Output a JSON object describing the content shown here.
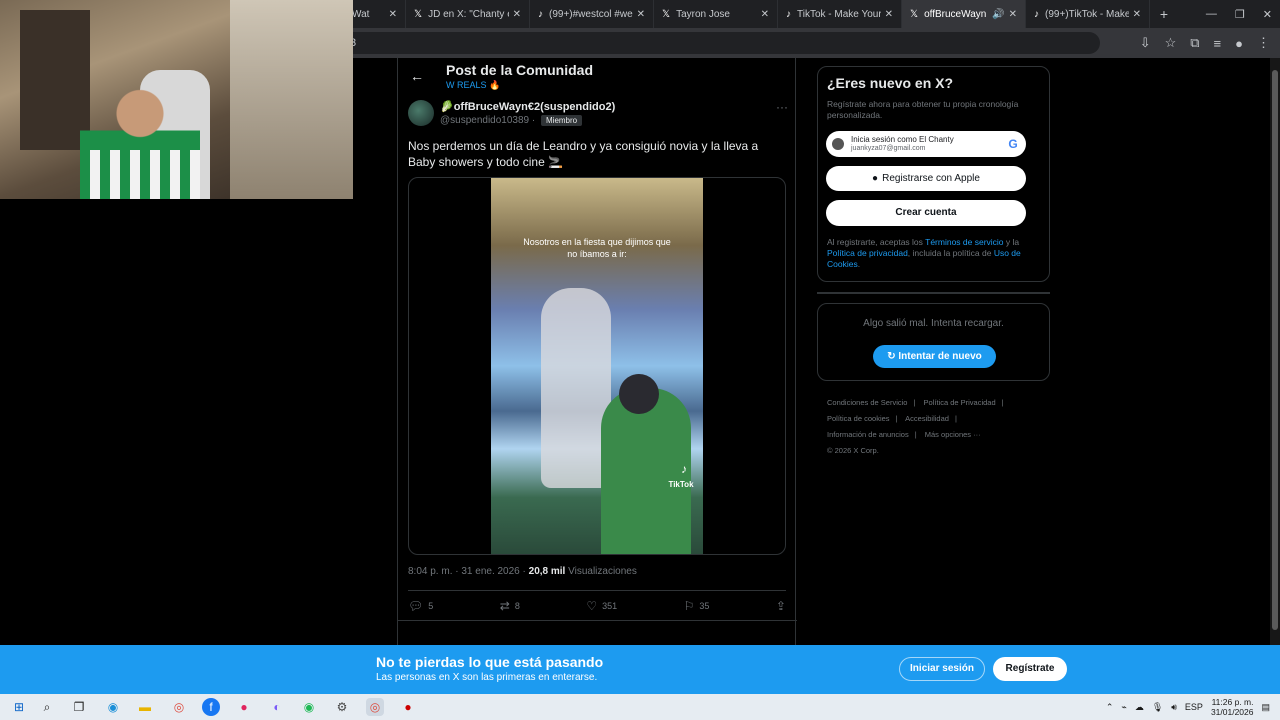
{
  "browser": {
    "tabs": [
      {
        "icon": "",
        "title": "Wat",
        "active": false
      },
      {
        "icon": "𝕏",
        "title": "JD en X: \"Chanty esta",
        "active": false
      },
      {
        "icon": "♪",
        "title": "(99+)#westcol #west",
        "active": false
      },
      {
        "icon": "𝕏",
        "title": "Tayron Jose",
        "active": false
      },
      {
        "icon": "♪",
        "title": "TikTok - Make Your D",
        "active": false
      },
      {
        "icon": "𝕏",
        "title": "offBruceWayn",
        "active": true
      },
      {
        "icon": "♪",
        "title": "(99+)TikTok - Make Y",
        "active": false
      }
    ],
    "new_tab": "+",
    "url_fragment": "3",
    "controls": {
      "minimize": "—",
      "restore": "❐",
      "close": "✕"
    }
  },
  "header": {
    "title": "Post de la Comunidad",
    "community": "W REALS 🔥"
  },
  "post": {
    "display_name": "🥬offBruceWayn€2(suspendido2)",
    "handle": "@suspendido10389 ·",
    "badge": "Miembro",
    "text": "Nos perdemos un día de Leandro y ya consiguió novia y la lleva a Baby showers y todo cine 🚬",
    "video_caption": "Nosotros en la fiesta que dijimos que no íbamos a ir:",
    "video_watermark": "TikTok",
    "time": "8:04 p. m. · 31 ene. 2026 ·",
    "views_count": "20,8 mil",
    "views_label": "Visualizaciones",
    "replies": "5",
    "reposts": "8",
    "likes": "351",
    "bookmarks": "35"
  },
  "signup": {
    "title": "¿Eres nuevo en X?",
    "subtitle": "Regístrate ahora para obtener tu propia cronología personalizada.",
    "google_line1": "Inicia sesión como El Chanty",
    "google_line2": "juankyza07@gmail.com",
    "google_logo": "G",
    "apple_label": "Registrarse con Apple",
    "create_label": "Crear cuenta",
    "legal_prefix": "Al registrarte, aceptas los",
    "legal_terms": "Términos de servicio",
    "legal_and": "y la",
    "legal_privacy": "Política de privacidad",
    "legal_including": ", incluida la política de",
    "legal_cookies": "Uso de Cookies",
    "legal_end": "."
  },
  "error": {
    "text": "Algo salió mal. Intenta recargar.",
    "retry_label": "Intentar de nuevo"
  },
  "footer": {
    "links": [
      "Condiciones de Servicio",
      "|",
      "Política de Privacidad",
      "|",
      "Política de cookies",
      "|",
      "Accesibilidad",
      "|",
      "Información de anuncios",
      "|",
      "Más opciones ···"
    ],
    "copyright": "© 2026 X Corp."
  },
  "banner": {
    "title": "No te pierdas lo que está pasando",
    "subtitle": "Las personas en X son las primeras en enterarse.",
    "login_label": "Iniciar sesión",
    "register_label": "Regístrate"
  },
  "taskbar": {
    "language": "ESP",
    "time": "11:26 p. m.",
    "date": "31/01/2026"
  },
  "colors": {
    "accent": "#1d9bf0",
    "background": "#000000",
    "border": "#2f3336"
  }
}
